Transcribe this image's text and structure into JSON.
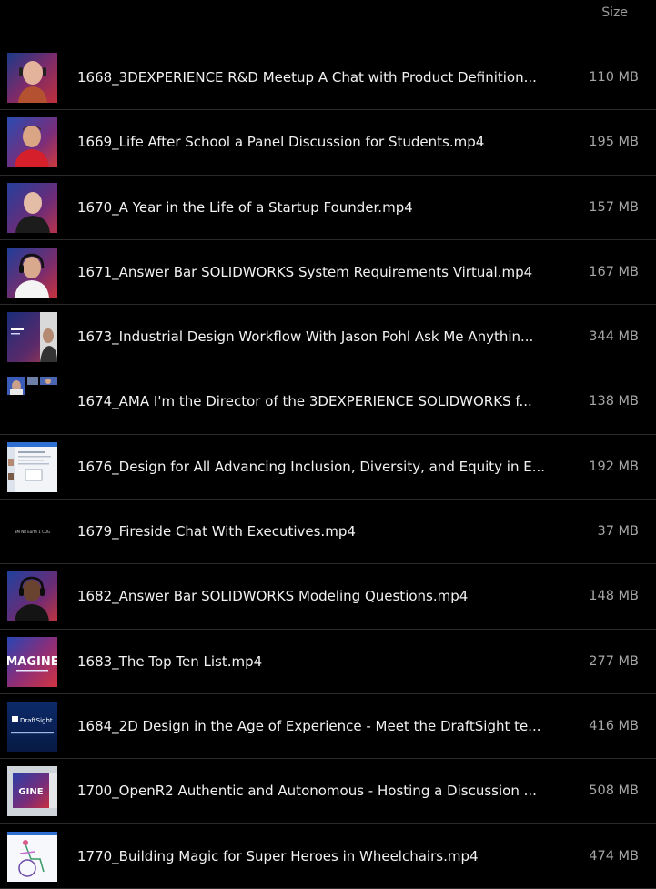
{
  "header": {
    "size_label": "Size"
  },
  "files": [
    {
      "name": "1668_3DEXPERIENCE R&D Meetup A Chat with Product Definition...",
      "size": "110 MB",
      "thumb": "person-bald-headset-icon"
    },
    {
      "name": "1669_Life After School a Panel Discussion for Students.mp4",
      "size": "195 MB",
      "thumb": "person-red-shirt-icon"
    },
    {
      "name": "1670_A Year in the Life of a Startup Founder.mp4",
      "size": "157 MB",
      "thumb": "person-dark-shirt-icon"
    },
    {
      "name": "1671_Answer Bar SOLIDWORKS System Requirements Virtual.mp4",
      "size": "167 MB",
      "thumb": "person-headset-white-shirt-icon"
    },
    {
      "name": "1673_Industrial Design Workflow With Jason Pohl Ask Me Anythin...",
      "size": "344 MB",
      "thumb": "slide-with-person-icon"
    },
    {
      "name": "1674_AMA I'm the Director of the 3DEXPERIENCE SOLIDWORKS f...",
      "size": "138 MB",
      "thumb": "video-call-grid-icon"
    },
    {
      "name": "1676_Design for All Advancing Inclusion, Diversity, and Equity in E...",
      "size": "192 MB",
      "thumb": "screen-share-document-icon"
    },
    {
      "name": "1679_Fireside Chat With Executives.mp4",
      "size": "37 MB",
      "thumb": "dark-title-card-icon",
      "thumb_text": "3M NR Earth 1 CDG"
    },
    {
      "name": "1682_Answer Bar SOLIDWORKS Modeling Questions.mp4",
      "size": "148 MB",
      "thumb": "person-headset-dark-shirt-icon"
    },
    {
      "name": "1683_The Top Ten List.mp4",
      "size": "277 MB",
      "thumb": "imagine-banner-icon",
      "thumb_text": "MAGINE"
    },
    {
      "name": "1684_2D Design in the Age of Experience - Meet the DraftSight te...",
      "size": "416 MB",
      "thumb": "draftsight-banner-icon",
      "thumb_text": "DraftSight"
    },
    {
      "name": "1700_OpenR2 Authentic and Autonomous - Hosting a Discussion ...",
      "size": "508 MB",
      "thumb": "imagine-slide-icon",
      "thumb_text": "GINE"
    },
    {
      "name": "1770_Building Magic for Super Heroes in Wheelchairs.mp4",
      "size": "474 MB",
      "thumb": "wheelchair-drawing-icon"
    }
  ],
  "colors": {
    "background": "#000000",
    "divider": "#2a2a2a",
    "name_text": "#f2f2f2",
    "size_text": "#a6a6a6",
    "header_text": "#9a9a9a"
  }
}
